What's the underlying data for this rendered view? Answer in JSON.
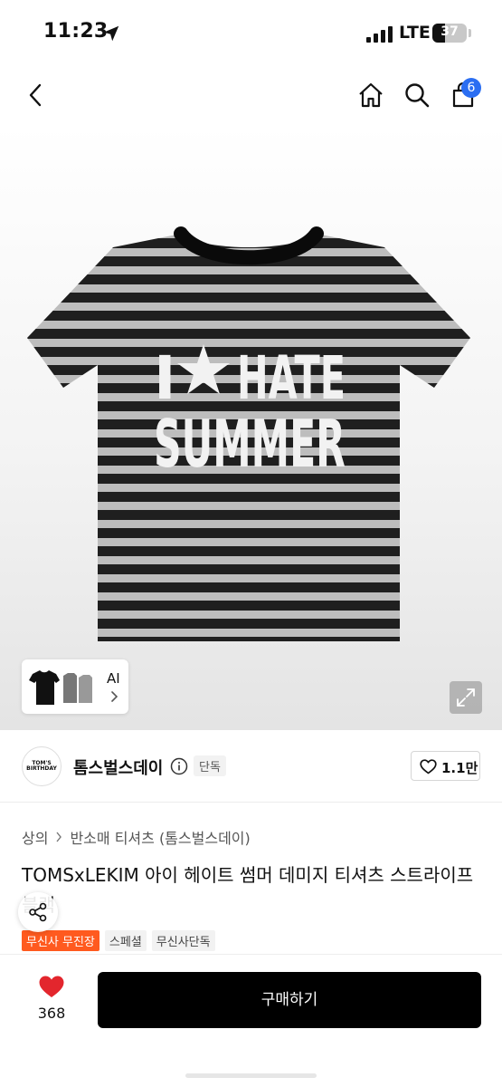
{
  "status_bar": {
    "time": "11:23",
    "carrier": "LTE",
    "battery": "37",
    "battery_level_percent": 37,
    "icons": [
      "location-arrow-icon",
      "signal-bars-icon",
      "battery-icon"
    ]
  },
  "nav": {
    "icons": [
      "back-chevron-icon",
      "home-icon",
      "search-icon",
      "cart-icon"
    ],
    "cart_count": "6",
    "badge_color": "#2b6ef2"
  },
  "product_image": {
    "print_line1_left": "I",
    "print_line1_right": "HATE",
    "print_line2": "SUMMER",
    "thumbnail_label": "AI",
    "icons": [
      "star-icon",
      "expand-icon",
      "chevron-right-icon"
    ]
  },
  "brand": {
    "logo_line1": "TOM'S",
    "logo_line2": "BIRTHDAY",
    "name": "톰스벌스데이",
    "badge": "단독",
    "like_count": "1.1만"
  },
  "product": {
    "breadcrumb": [
      "상의",
      "반소매 티셔츠 (톰스벌스데이)"
    ],
    "title": "TOMSxLEKIM 아이 헤이트 썸머 데미지 티셔츠 스트라이프 블랙",
    "tags": [
      "무신사 무진장",
      "스페셜",
      "무신사단독"
    ],
    "accent_color": "#ff5a1f"
  },
  "bottom_bar": {
    "wish_count": "368",
    "wish_color": "#e3262d",
    "buy_label": "구매하기"
  }
}
